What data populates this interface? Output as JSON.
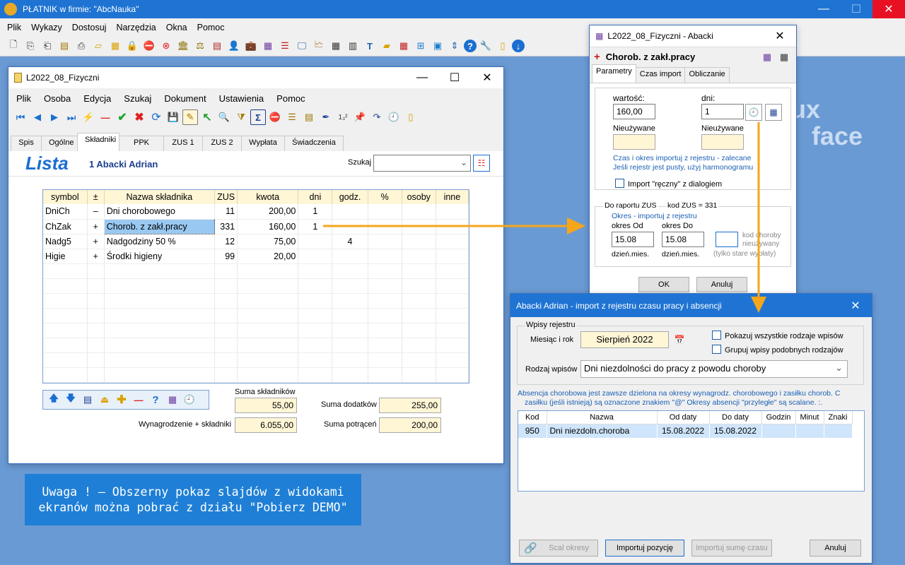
{
  "app": {
    "title": "PŁATNIK  w firmie:  \"AbcNauka\"",
    "menu": [
      "Plik",
      "Wykazy",
      "Dostosuj",
      "Narzędzia",
      "Okna",
      "Pomoc"
    ]
  },
  "background_text": {
    "line1": "ux",
    "line2": "face"
  },
  "main_window": {
    "title": "L2022_08_Fizyczni",
    "menu": [
      "Plik",
      "Osoba",
      "Edycja",
      "Szukaj",
      "Dokument",
      "Ustawienia",
      "Pomoc"
    ],
    "tabs": [
      "Spis",
      "Ogólne",
      "Składniki",
      "PPK",
      "ZUS 1",
      "ZUS 2",
      "Wypłata",
      "Świadczenia"
    ],
    "active_tab": "Składniki",
    "heading": "Lista",
    "person": "1 Abacki Adrian",
    "search_label": "Szukaj",
    "table": {
      "headers": [
        "symbol",
        "±",
        "Nazwa składnika",
        "ZUS",
        "kwota",
        "dni",
        "godz.",
        "%",
        "osoby",
        "inne"
      ],
      "rows": [
        [
          "DniCh",
          "–",
          "Dni chorobowego",
          "11",
          "200,00",
          "1",
          "",
          "",
          "",
          ""
        ],
        [
          "ChZak",
          "+",
          "Chorob. z zakł.pracy",
          "331",
          "160,00",
          "1",
          "",
          "",
          "",
          ""
        ],
        [
          "Nadg5",
          "+",
          "Nadgodziny 50 %",
          "12",
          "75,00",
          "",
          "4",
          "",
          "",
          ""
        ],
        [
          "Higie",
          "+",
          "Środki higieny",
          "99",
          "20,00",
          "",
          "",
          "",
          "",
          ""
        ]
      ]
    },
    "summary": {
      "suma_skladnikow_label": "Suma składników",
      "suma_skladnikow": "55,00",
      "suma_dodatkow_label": "Suma dodatków",
      "suma_dodatkow": "255,00",
      "wynagrodzenie_label": "Wynagrodzenie + składniki",
      "wynagrodzenie": "6.055,00",
      "suma_potracen_label": "Suma potrąceń",
      "suma_potracen": "200,00"
    }
  },
  "notice": {
    "line1": "Uwaga ! – Obszerny pokaz slajdów z widokami",
    "line2": "ekranów można pobrać z działu \"Pobierz DEMO\""
  },
  "abacki_window": {
    "title": "L2022_08_Fizyczni  -  Abacki",
    "header": "Chorob. z zakł.pracy",
    "tabs": [
      "Parametry",
      "Czas import",
      "Obliczanie"
    ],
    "wartosc_label": "wartość:",
    "wartosc": "160,00",
    "dni_label": "dni:",
    "dni": "1",
    "unused1": "Nieużywane",
    "unused2": "Nieużywane",
    "info1": "Czas i okres importuj z rejestru - zalecane",
    "info2": "Jeśli rejestr jest pusty, użyj  harmonogramu",
    "import_label": "Import \"ręczny\" z dialogiem",
    "raport_label": "Do raportu ZUS",
    "kod_zus": "kod ZUS = 331",
    "okres_label": "Okres - importuj z rejestru",
    "od_label": "okres  Od",
    "do_label": "okres  Do",
    "od": "15.08",
    "do": "15.08",
    "dzien_mies_1": "dzień.mies.",
    "dzien_mies_2": "dzień.mies.",
    "kod_choroby_1": "kod choroby",
    "kod_choroby_2": "nieużywany",
    "kod_choroby_3": "(tylko stare wypłaty)",
    "ok": "OK",
    "cancel": "Anuluj"
  },
  "import_window": {
    "title": "Abacki Adrian  -  import z rejestru  czasu pracy i absencji",
    "group": "Wpisy rejestru",
    "month_label": "Miesiąc  i  rok",
    "month": "Sierpień  2022",
    "show_all": "Pokazuj wszystkie rodzaje wpisów",
    "group_similar": "Grupuj wpisy podobnych rodzajów",
    "rodzaj_label": "Rodzaj wpisów",
    "rodzaj": "Dni niezdolności do pracy z powodu choroby",
    "note1": "Absencja chorobowa jest zawsze dzielona na okresy wynagrodz. chorobowego i zasiłku chorob.  C",
    "note2": "zasiłku (jeśli istnieją) są oznaczone znakiem \"@\"  Okresy absencji  \"przyległe\" są scalane.  :.",
    "headers": [
      "Kod",
      "Nazwa",
      "Od daty",
      "Do daty",
      "Godzin",
      "Minut",
      "Znaki"
    ],
    "rows": [
      [
        "950",
        "Dni niezdoln.choroba",
        "15.08.2022",
        "15.08.2022",
        "",
        "",
        ""
      ]
    ],
    "buttons": {
      "scal": "Scal okresy",
      "importuj": "Importuj pozycję",
      "importuj_sume": "Importuj sumę czasu",
      "anuluj": "Anuluj"
    }
  }
}
